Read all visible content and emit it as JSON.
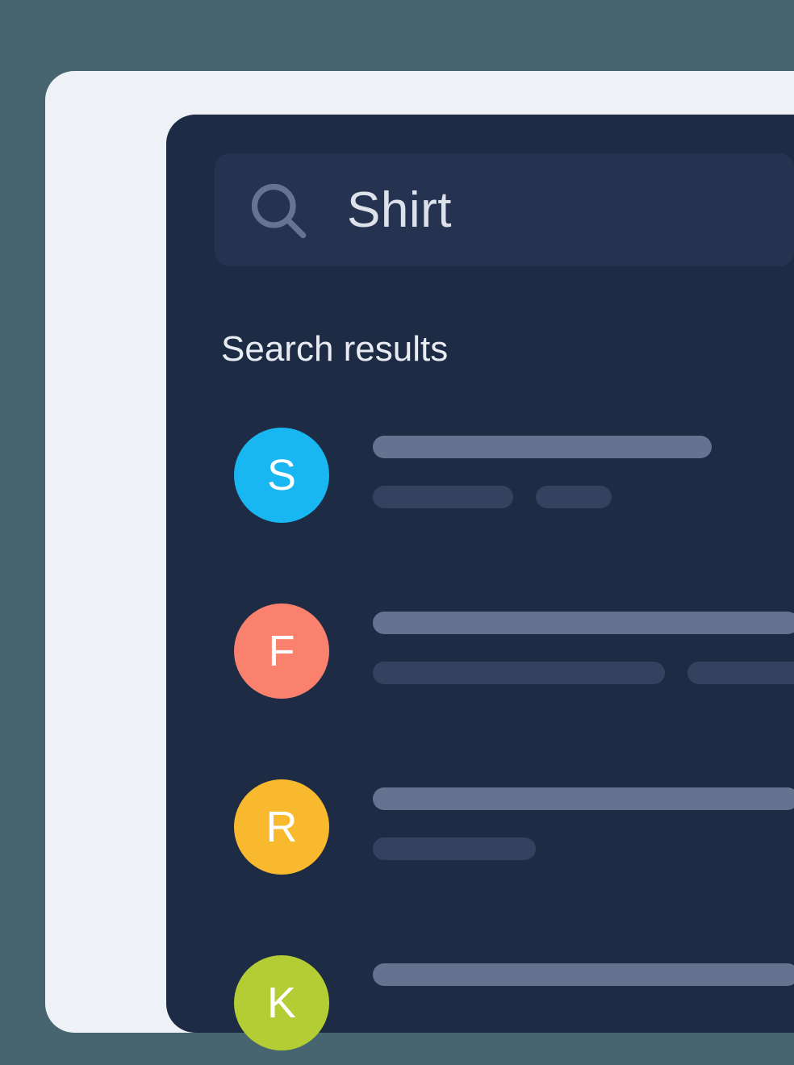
{
  "search": {
    "value": "Shirt"
  },
  "results_heading": "Search results",
  "results": [
    {
      "letter": "S",
      "color": "#18b7f2"
    },
    {
      "letter": "F",
      "color": "#fa816d"
    },
    {
      "letter": "R",
      "color": "#f8b92e"
    },
    {
      "letter": "K",
      "color": "#b4cd35"
    }
  ]
}
